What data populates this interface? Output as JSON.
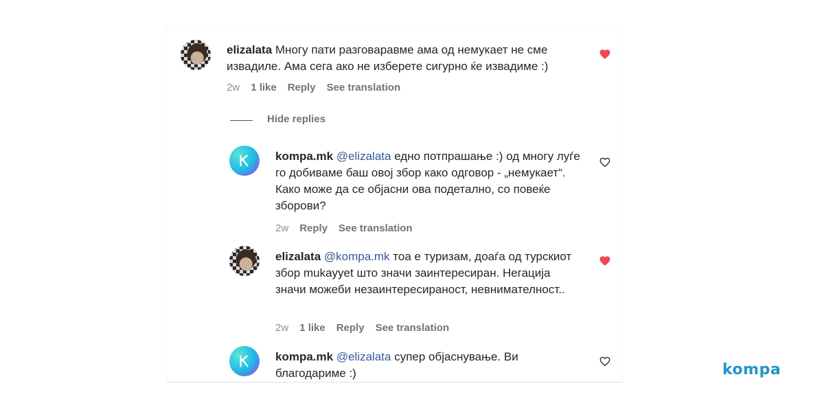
{
  "colors": {
    "liked_heart": "#ed4956",
    "mention": "#385898",
    "meta": "#737373",
    "brand": "#2196c9"
  },
  "comments": [
    {
      "username": "elizalata",
      "mention": "",
      "text": "Многу пати разговаравме ама од немукает не сме извадиле. Ама сега ако не изберете сигурно ќе извадиме :)",
      "time": "2w",
      "likes": "1 like",
      "reply": "Reply",
      "translate": "See translation",
      "liked": true,
      "avatar_icon": "profile-photo-icon"
    },
    {
      "username": "kompa.mk",
      "mention": "@elizalata",
      "text": " едно потпрашање :) од многу луѓе го добиваме баш овој збор како одговор - „немукает“. Како може да се објасни ова подетално, со повеќе зборови?",
      "time": "2w",
      "likes": "",
      "reply": "Reply",
      "translate": "See translation",
      "liked": false,
      "avatar_icon": "kompa-logo-icon"
    },
    {
      "username": "elizalata",
      "mention": "@kompa.mk",
      "text": " тоа е туризам, доаѓа од турскиот збор mukayyet што значи заинтересиран. Негација значи можеби незаинтересираност, невнимателност..",
      "time": "2w",
      "likes": "1 like",
      "reply": "Reply",
      "translate": "See translation",
      "liked": true,
      "avatar_icon": "profile-photo-icon"
    },
    {
      "username": "kompa.mk",
      "mention": "@elizalata",
      "text": " супер објаснување. Ви благодариме :)",
      "time": "",
      "likes": "",
      "reply": "",
      "translate": "",
      "liked": false,
      "avatar_icon": "kompa-logo-icon"
    }
  ],
  "hide_replies": "Hide replies",
  "brand_logo": "kompa"
}
